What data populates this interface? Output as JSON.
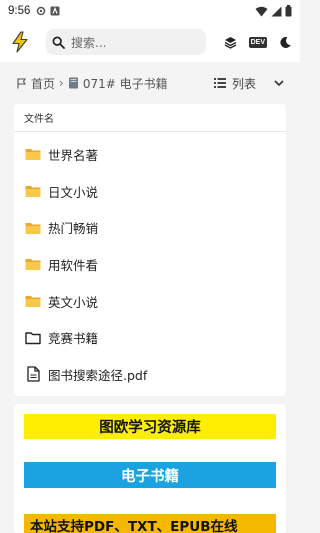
{
  "status_bar": {
    "time": "9:56"
  },
  "header": {
    "search_placeholder": "搜索...",
    "dev_label": "DEV"
  },
  "breadcrumb": {
    "home": "首页",
    "current": "071# 电子书籍"
  },
  "view": {
    "label": "列表"
  },
  "file_list": {
    "column_header": "文件名",
    "items": [
      {
        "name": "世界名著",
        "icon": "folder-yellow-icon"
      },
      {
        "name": "日文小说",
        "icon": "folder-yellow-icon"
      },
      {
        "name": "热门畅销",
        "icon": "folder-yellow-icon"
      },
      {
        "name": "用软件看",
        "icon": "folder-yellow-icon"
      },
      {
        "name": "英文小说",
        "icon": "folder-yellow-icon"
      },
      {
        "name": "竞赛书籍",
        "icon": "folder-outline-icon"
      },
      {
        "name": "图书搜索途径.pdf",
        "icon": "file-icon"
      }
    ]
  },
  "ads": [
    {
      "text": "图欧学习资源库",
      "bg": "#ffee00"
    },
    {
      "text": "电子书籍",
      "bg": "#1aa3e0"
    },
    {
      "text": "本站支持PDF、TXT、EPUB在线",
      "bg": "#f5b800"
    }
  ],
  "colors": {
    "accent": "#f5c400",
    "panel": "#ffffff",
    "background": "#f4f4f4"
  }
}
